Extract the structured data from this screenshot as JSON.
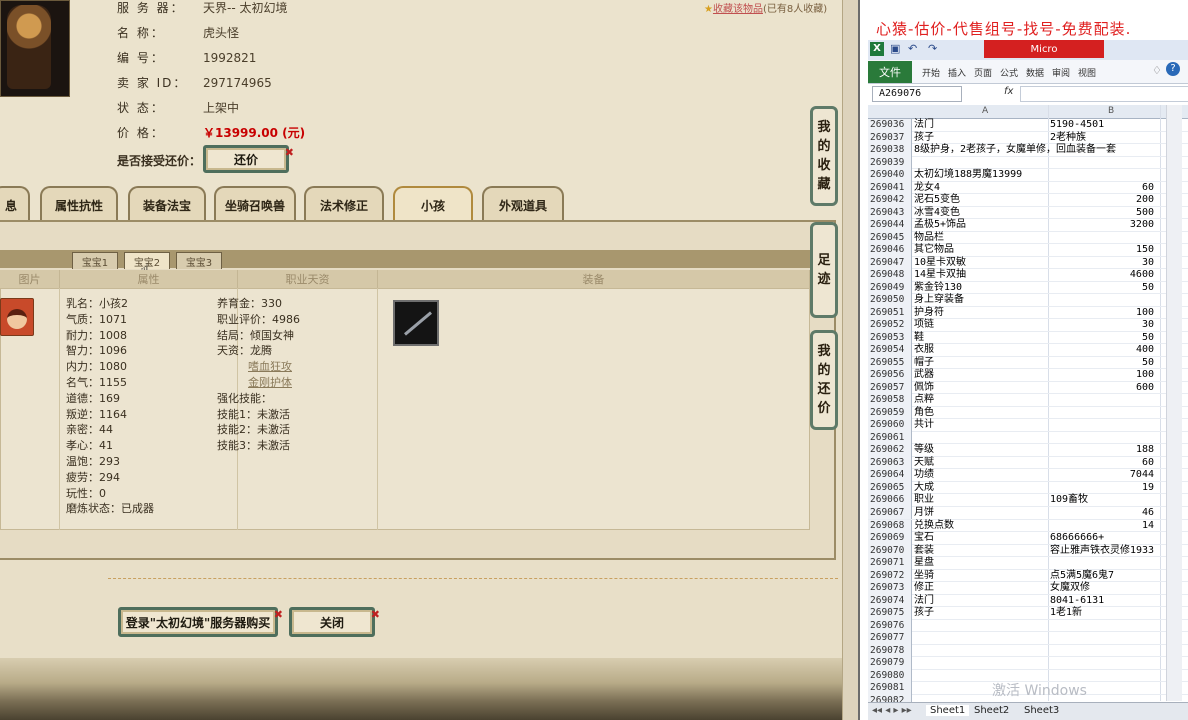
{
  "game": {
    "info": {
      "server_label": "服 务 器：",
      "server_value": "天界-- 太初幻境",
      "name_label": "名 称：",
      "name_value": "虎头怪",
      "id_label": "编 号：",
      "id_value": "1992821",
      "seller_label": "卖 家 ID：",
      "seller_value": "297174965",
      "status_label": "状 态：",
      "status_value": "上架中",
      "price_label": "价 格：",
      "price_value": "￥13999.00 (元)",
      "accept_label": "是否接受还价：",
      "counter_button": "还价"
    },
    "fav_link": "收藏该物品",
    "fav_count": "(已有8人收藏)",
    "tabs": [
      "息",
      "属性抗性",
      "装备法宝",
      "坐骑召唤兽",
      "法术修正",
      "小孩",
      "外观道具"
    ],
    "active_tab": "小孩",
    "side_buttons": [
      "我的收藏",
      "足迹",
      "我的还价"
    ],
    "subtabs": [
      "宝宝1",
      "宝宝2",
      "宝宝3"
    ],
    "active_subtab": "宝宝2",
    "columns": [
      "图片",
      "属性",
      "职业天资",
      "装备"
    ],
    "attributes": [
      "乳名：小孩2",
      "气质：1071",
      "耐力：1008",
      "智力：1096",
      "内力：1080",
      "名气：1155",
      "道德：169",
      "叛逆：1164",
      "亲密：44",
      "孝心：41",
      "温饱：293",
      "疲劳：294",
      "玩性：0",
      "磨炼状态：已成器"
    ],
    "career": [
      "养育金：330",
      "职业评价：4986",
      "结局：倾国女神",
      "天资：龙腾",
      "嗜血狂攻",
      "金刚护体",
      "强化技能：",
      "技能1：未激活",
      "技能2：未激活",
      "技能3：未激活"
    ],
    "login_button": "登录\"太初幻境\"服务器购买",
    "close_button": "关闭"
  },
  "excel": {
    "ad_text": "心猿-估价-代售组号-找号-免费配装.",
    "title_snippet": "Micro",
    "file_tab": "文件",
    "ribbon_tabs": [
      "开始",
      "插入",
      "页面",
      "公式",
      "数据",
      "审阅",
      "视图"
    ],
    "name_box": "A269076",
    "fx": "fx",
    "col_a": "A",
    "col_b": "B",
    "rows": [
      [
        "269036",
        "法门",
        "5190-4501",
        false
      ],
      [
        "269037",
        "孩子",
        "2老种族",
        false
      ],
      [
        "269038",
        "8级护身，2老孩子，女魔单修，回血装备一套",
        "",
        false
      ],
      [
        "269039",
        "",
        "",
        false
      ],
      [
        "269040",
        "太初幻境188男魔13999",
        "",
        false
      ],
      [
        "269041",
        "龙女4",
        "60",
        true
      ],
      [
        "269042",
        "泥石5变色",
        "200",
        true
      ],
      [
        "269043",
        "冰雪4变色",
        "500",
        true
      ],
      [
        "269044",
        "孟极5+饰品",
        "3200",
        true
      ],
      [
        "269045",
        "物品栏",
        "",
        false
      ],
      [
        "269046",
        "其它物品",
        "150",
        true
      ],
      [
        "269047",
        "10星卡双敏",
        "30",
        true
      ],
      [
        "269048",
        "14星卡双抽",
        "4600",
        true
      ],
      [
        "269049",
        "紫金铃130",
        "50",
        true
      ],
      [
        "269050",
        "身上穿装备",
        "",
        false
      ],
      [
        "269051",
        "护身符",
        "100",
        true
      ],
      [
        "269052",
        "项链",
        "30",
        true
      ],
      [
        "269053",
        "鞋",
        "50",
        true
      ],
      [
        "269054",
        "衣服",
        "400",
        true
      ],
      [
        "269055",
        "帽子",
        "50",
        true
      ],
      [
        "269056",
        "武器",
        "100",
        true
      ],
      [
        "269057",
        "佩饰",
        "600",
        true
      ],
      [
        "269058",
        "点粹",
        "",
        false
      ],
      [
        "269059",
        "角色",
        "",
        false
      ],
      [
        "269060",
        "共计",
        "",
        false
      ],
      [
        "269061",
        "",
        "",
        false
      ],
      [
        "269062",
        "等级",
        "188",
        true
      ],
      [
        "269063",
        "天赋",
        "60",
        true
      ],
      [
        "269064",
        "功绩",
        "7044",
        true
      ],
      [
        "269065",
        "大成",
        "19",
        true
      ],
      [
        "269066",
        "职业",
        "109畜牧",
        false
      ],
      [
        "269067",
        "月饼",
        "46",
        true
      ],
      [
        "269068",
        "兑换点数",
        "14",
        true
      ],
      [
        "269069",
        "宝石",
        "68666666+",
        false
      ],
      [
        "269070",
        "套装",
        "容止雅声铁衣灵修1933",
        false
      ],
      [
        "269071",
        "星盘",
        "",
        false
      ],
      [
        "269072",
        "坐骑",
        "点5满5魔6鬼7",
        false
      ],
      [
        "269073",
        "修正",
        "女魔双修",
        false
      ],
      [
        "269074",
        "法门",
        "8041-6131",
        false
      ],
      [
        "269075",
        "孩子",
        "1老1新",
        false
      ],
      [
        "269076",
        "",
        "",
        false
      ],
      [
        "269077",
        "",
        "",
        false
      ],
      [
        "269078",
        "",
        "",
        false
      ],
      [
        "269079",
        "",
        "",
        false
      ],
      [
        "269080",
        "",
        "",
        false
      ],
      [
        "269081",
        "",
        "",
        false
      ],
      [
        "269082",
        "",
        "",
        false
      ]
    ],
    "sheets": [
      "Sheet1",
      "Sheet2",
      "Sheet3"
    ],
    "watermark": "激活 Windows"
  }
}
